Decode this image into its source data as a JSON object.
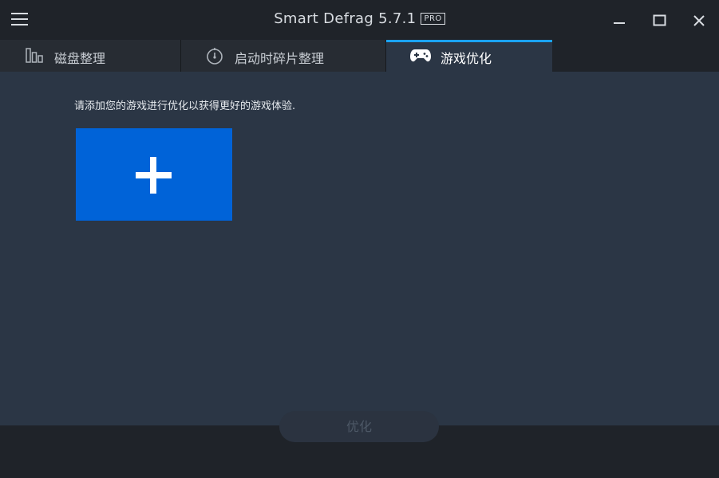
{
  "titlebar": {
    "app_name": "Smart Defrag 5.7.1",
    "edition_badge": "PRO"
  },
  "tabs": [
    {
      "label": "磁盘整理",
      "icon": "disk-columns-icon",
      "active": false
    },
    {
      "label": "启动时碎片整理",
      "icon": "boot-timer-icon",
      "active": false
    },
    {
      "label": "游戏优化",
      "icon": "gamepad-icon",
      "active": true
    }
  ],
  "main": {
    "hint": "请添加您的游戏进行优化以获得更好的游戏体验."
  },
  "footer": {
    "optimize_label": "优化"
  },
  "colors": {
    "accent": "#1aa3ff",
    "tile": "#0063d8",
    "panel": "#2b3645",
    "chrome": "#1f2329"
  }
}
